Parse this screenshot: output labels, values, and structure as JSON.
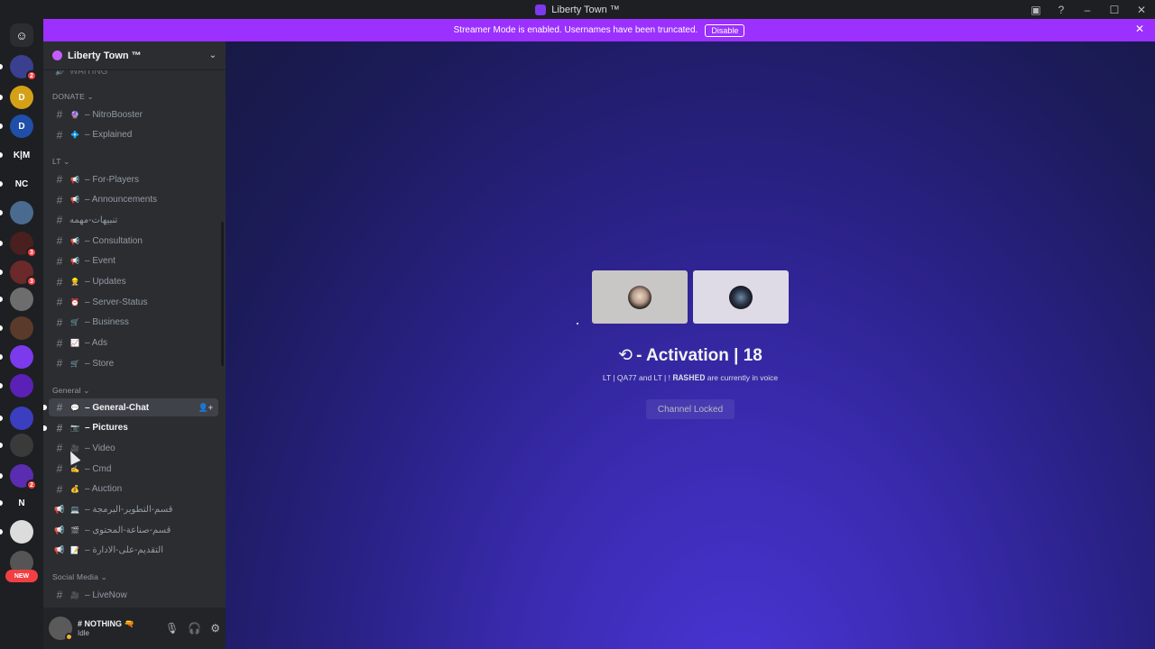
{
  "window": {
    "title": "Liberty Town ™",
    "controls": [
      "minimize",
      "maximize",
      "close"
    ]
  },
  "banner": {
    "text": "Streamer Mode is enabled. Usernames have been truncated.",
    "button": "Disable"
  },
  "servers": [
    {
      "label": "",
      "icon": "discord-home-icon",
      "color": "#2b2d31"
    },
    {
      "label": "",
      "icon": "server-icon",
      "color": "#3a3f8f",
      "badge": "2"
    },
    {
      "label": "D",
      "icon": "server-icon",
      "color": "#d4a017"
    },
    {
      "label": "D",
      "icon": "server-icon",
      "color": "#1f4fa8"
    },
    {
      "label": "K|M",
      "icon": "server-icon",
      "color": "#1e1f22"
    },
    {
      "label": "NC",
      "icon": "server-icon",
      "color": "#1e1f22"
    },
    {
      "label": "",
      "icon": "server-icon",
      "color": "#4a6b8f"
    },
    {
      "label": "",
      "icon": "server-icon",
      "color": "#4a1f1f",
      "badge": "3"
    },
    {
      "label": "",
      "icon": "server-icon",
      "color": "#6a2a2a",
      "badge": "3"
    },
    {
      "label": "",
      "icon": "server-icon",
      "color": "#6d6d6d"
    },
    {
      "label": "",
      "icon": "server-icon",
      "color": "#5a3a2a"
    },
    {
      "label": "",
      "icon": "server-icon",
      "color": "#7c3aed"
    },
    {
      "label": "",
      "icon": "server-icon",
      "color": "#5b21b6"
    },
    {
      "label": "",
      "icon": "folder-icon",
      "color": "#3b3fbf"
    },
    {
      "label": "",
      "icon": "server-icon",
      "color": "#3a3a3a"
    },
    {
      "label": "",
      "icon": "server-icon",
      "color": "#5a2db0",
      "badge": "2"
    },
    {
      "label": "N",
      "icon": "server-icon",
      "color": "#1e1f22"
    },
    {
      "label": "",
      "icon": "server-icon",
      "color": "#dcdcdc"
    },
    {
      "label": "",
      "icon": "server-icon",
      "color": "#555"
    }
  ],
  "new_label": "NEW",
  "guild": {
    "name": "Liberty Town ™"
  },
  "categories": {
    "waiting": "WAITING",
    "donate": "DONATE",
    "lt": "LT",
    "general": "General",
    "social": "Social Media"
  },
  "channels": {
    "donate": [
      {
        "emoji": "🔮",
        "name": "– NitroBooster"
      },
      {
        "emoji": "💠",
        "name": "– Explained"
      }
    ],
    "lt": [
      {
        "emoji": "📢",
        "name": "– For-Players"
      },
      {
        "emoji": "📢",
        "name": "– Announcements"
      },
      {
        "emoji": "",
        "name": "تنبيهات-مهمه"
      },
      {
        "emoji": "📢",
        "name": "– Consultation"
      },
      {
        "emoji": "📢",
        "name": "– Event"
      },
      {
        "emoji": "👷",
        "name": "– Updates"
      },
      {
        "emoji": "⏰",
        "name": "– Server-Status"
      },
      {
        "emoji": "🛒",
        "name": "– Business"
      },
      {
        "emoji": "📈",
        "name": "– Ads"
      },
      {
        "emoji": "🛒",
        "name": "– Store"
      }
    ],
    "general": [
      {
        "emoji": "💬",
        "name": "– General-Chat",
        "type": "text"
      },
      {
        "emoji": "📷",
        "name": "– Pictures",
        "type": "text"
      },
      {
        "emoji": "🎥",
        "name": "– Video",
        "type": "text"
      },
      {
        "emoji": "✍️",
        "name": "– Cmd",
        "type": "text"
      },
      {
        "emoji": "💰",
        "name": "– Auction",
        "type": "text"
      },
      {
        "emoji": "💻",
        "name": "– قسم-التطوير-البرمجة",
        "type": "announce"
      },
      {
        "emoji": "🎬",
        "name": "– قسم-صناعة-المحتوى",
        "type": "announce"
      },
      {
        "emoji": "📝",
        "name": "– التقديم-على-الادارة",
        "type": "announce"
      }
    ],
    "social": [
      {
        "emoji": "🎥",
        "name": "– LiveNow"
      }
    ]
  },
  "user": {
    "name": "# NOTHING 🔫",
    "status": "Idle"
  },
  "voice": {
    "title": "- Activation | 18",
    "subtitle": "LT | QA77 and LT | ! 𝐑𝐀𝐒𝐇𝐄𝐃 are currently in voice",
    "button": "Channel Locked"
  }
}
